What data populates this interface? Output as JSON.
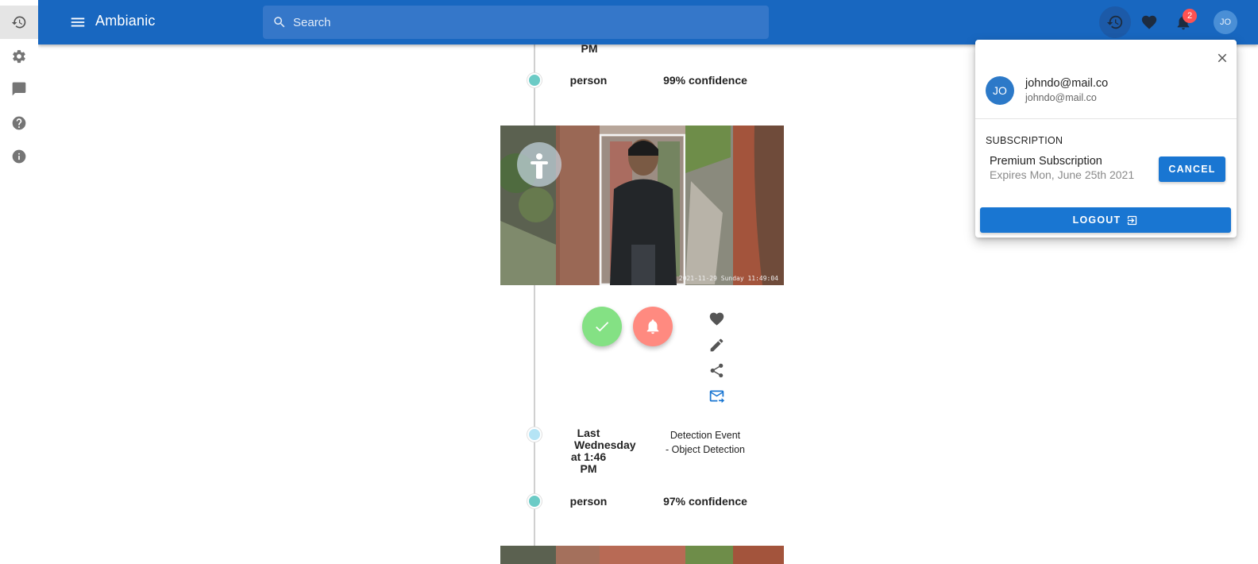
{
  "app": {
    "title": "Ambianic"
  },
  "search": {
    "placeholder": "Search"
  },
  "nav_rail": [
    "history-icon",
    "settings-icon",
    "feedback-icon",
    "help-icon",
    "info-icon"
  ],
  "toolbar_icons": [
    "history-icon",
    "heart-icon",
    "bell-icon"
  ],
  "notifications": {
    "count": "2"
  },
  "account": {
    "initials": "JO",
    "name": "johndo@mail.co",
    "email": "johndo@mail.co"
  },
  "subscription": {
    "heading": "SUBSCRIPTION",
    "name": "Premium Subscription",
    "expires": "Expires Mon, June 25th 2021",
    "cancel_label": "CANCEL"
  },
  "logout_label": "LOGOUT",
  "timeline": {
    "event1": {
      "time_tail": "PM",
      "label": "person",
      "confidence": "99% confidence",
      "photo_timestamp": "2021-11-29 Sunday 11:49:04"
    },
    "event2": {
      "time_line1": "Last",
      "time_line2": "Wednesday",
      "time_line3": "at 1:46",
      "time_line4": "PM",
      "type": "Detection Event",
      "subtype": "- Object Detection",
      "label": "person",
      "confidence": "97% confidence"
    }
  },
  "colors": {
    "appbar": "#1867c0",
    "accent": "#1976d2",
    "approve_fab": "#84e184",
    "alert_fab": "#ff8a80",
    "dot_teal": "#6ccbc6",
    "dot_light": "#b5e4f5",
    "badge": "#ff5252"
  }
}
